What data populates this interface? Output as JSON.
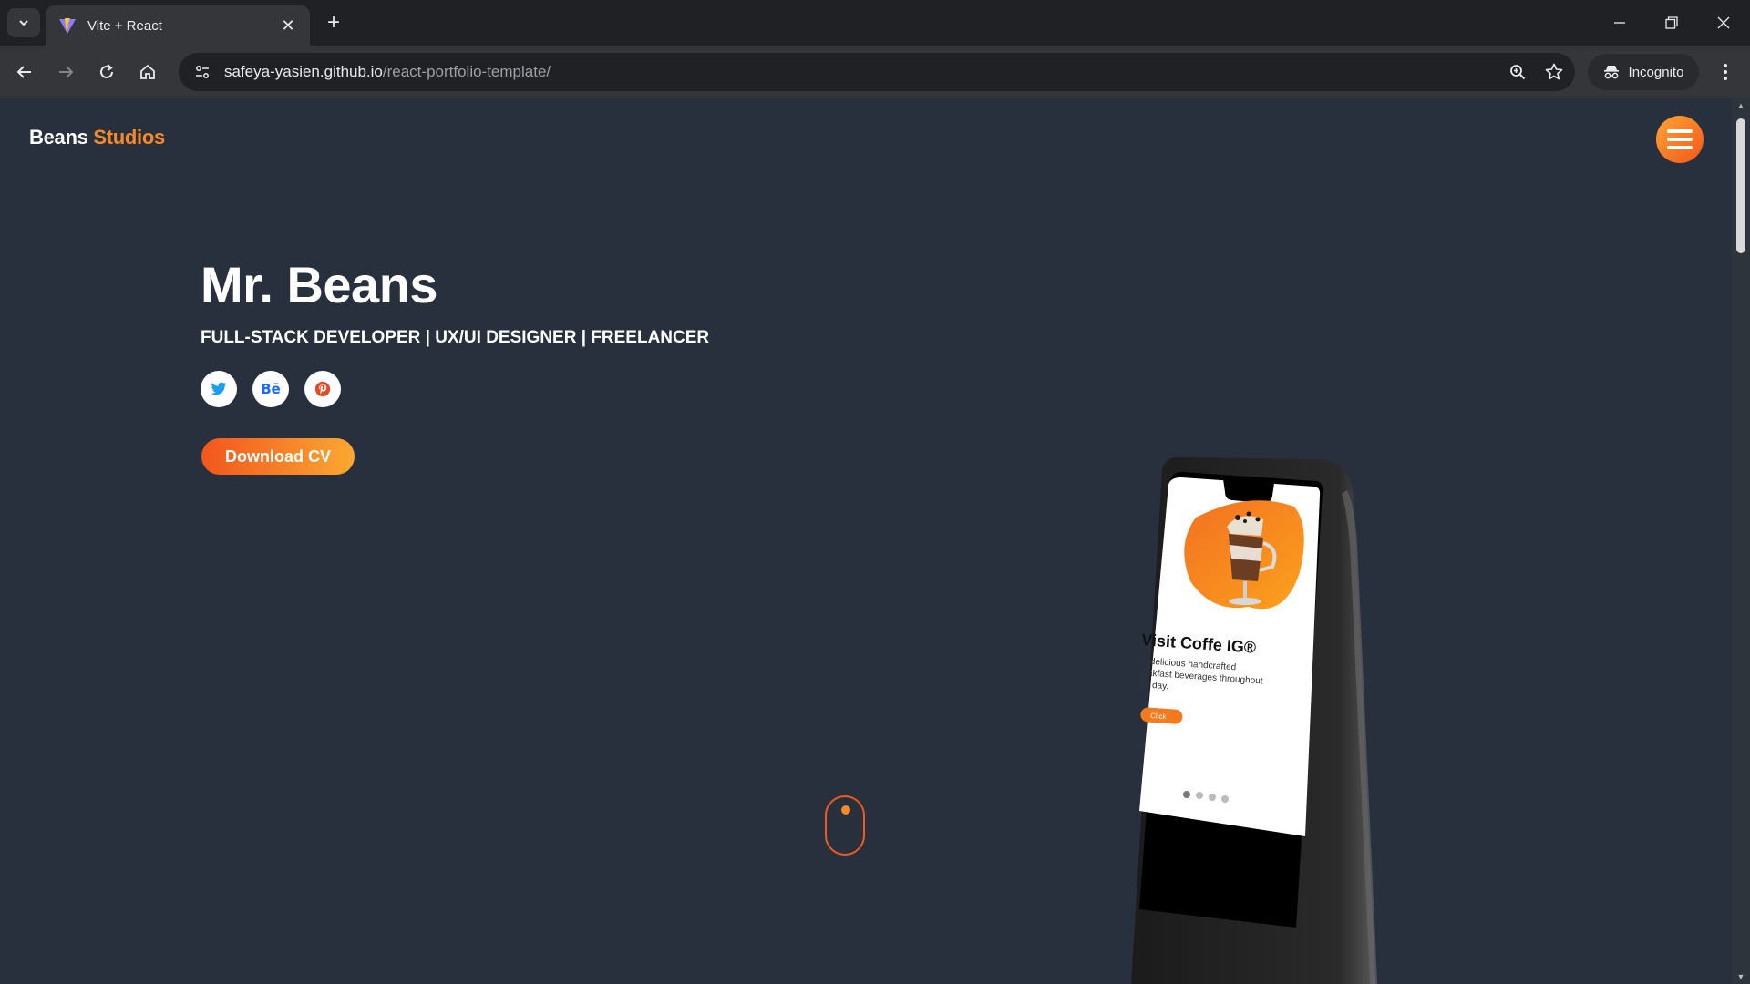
{
  "browser": {
    "tab_title": "Vite + React",
    "url_host": "safeya-yasien.github.io",
    "url_path": "/react-portfolio-template/",
    "profile_label": "Incognito"
  },
  "page": {
    "brand_main": "Beans",
    "brand_accent": "Studios",
    "hero_name": "Mr. Beans",
    "hero_subtitle": "FULL-STACK DEVELOPER | UX/UI DESIGNER | FREELANCER",
    "social_twitter_label": "",
    "social_behance_label": "Bē",
    "cv_button": "Download CV",
    "phone_screen": {
      "heading": "Visit Coffe IG®",
      "body_line1": "or delicious handcrafted",
      "body_line2": "reakfast beverages throughout",
      "body_line3": "he day.",
      "button": "Click"
    }
  },
  "colors": {
    "page_bg": "#27303c",
    "accent_orange": "#f58a2a",
    "gradient_start": "#f2561c",
    "gradient_end": "#fba832"
  },
  "icons": [
    "tab-search-icon",
    "vite-favicon-icon",
    "close-icon",
    "plus-icon",
    "minimize-icon",
    "restore-icon",
    "window-close-icon",
    "back-icon",
    "forward-icon",
    "reload-icon",
    "home-icon",
    "site-info-icon",
    "zoom-icon",
    "bookmark-star-icon",
    "incognito-icon",
    "more-vert-icon",
    "hamburger-icon",
    "twitter-icon",
    "behance-icon",
    "pinterest-icon",
    "scroll-mouse-icon"
  ]
}
